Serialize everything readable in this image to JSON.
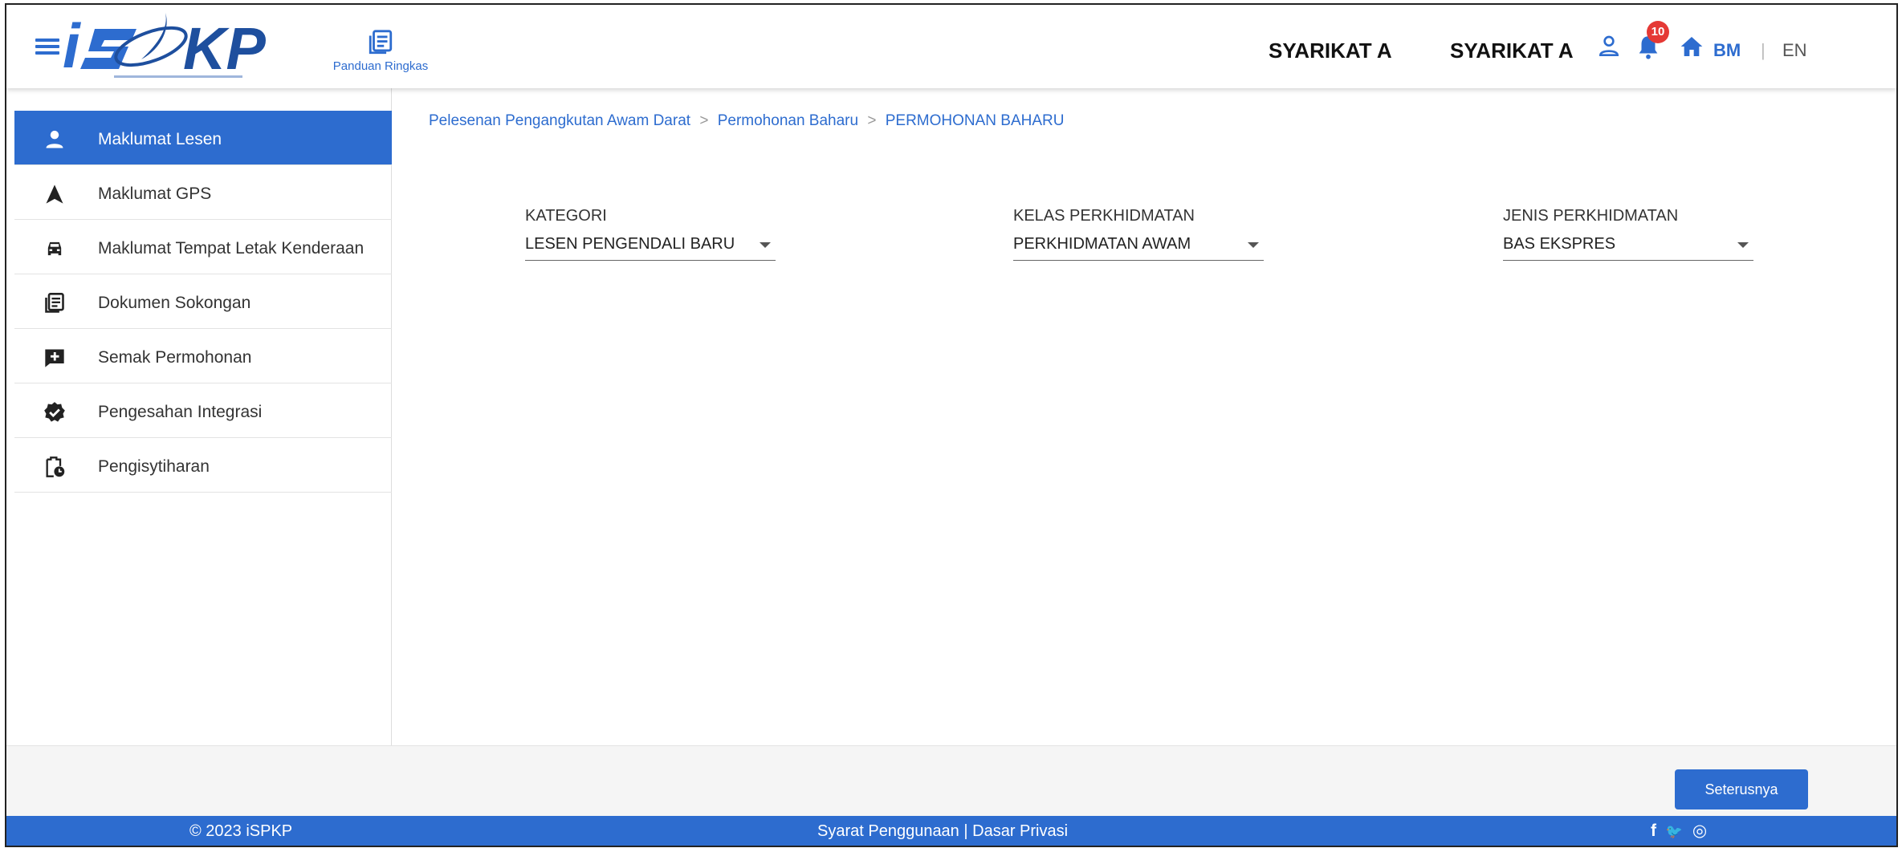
{
  "header": {
    "logo_text": "iSPKP",
    "guide_label": "Panduan Ringkas",
    "company_1": "SYARIKAT A",
    "company_2": "SYARIKAT A",
    "notification_count": "10",
    "lang_bm": "BM",
    "lang_sep": "|",
    "lang_en": "EN",
    "icons": [
      "menu-icon",
      "book-icon",
      "user-icon",
      "bell-icon",
      "home-icon"
    ]
  },
  "sidebar": {
    "items": [
      {
        "label": "Maklumat Lesen",
        "icon": "person-icon",
        "active": true
      },
      {
        "label": "Maklumat GPS",
        "icon": "navigation-arrow-icon",
        "active": false
      },
      {
        "label": "Maklumat Tempat Letak Kenderaan",
        "icon": "car-icon",
        "active": false
      },
      {
        "label": "Dokumen Sokongan",
        "icon": "document-stack-icon",
        "active": false
      },
      {
        "label": "Semak Permohonan",
        "icon": "comment-plus-icon",
        "active": false
      },
      {
        "label": "Pengesahan Integrasi",
        "icon": "verified-badge-icon",
        "active": false
      },
      {
        "label": "Pengisytiharan",
        "icon": "clipboard-clock-icon",
        "active": false
      }
    ]
  },
  "breadcrumb": {
    "items": [
      "Pelesenan Pengangkutan Awam Darat",
      "Permohonan Baharu",
      "PERMOHONAN BAHARU"
    ],
    "separator": ">"
  },
  "form": {
    "kategori": {
      "label": "KATEGORI",
      "value": "LESEN PENGENDALI BARU"
    },
    "kelas": {
      "label": "KELAS PERKHIDMATAN",
      "value": "PERKHIDMATAN AWAM"
    },
    "jenis": {
      "label": "JENIS PERKHIDMATAN",
      "value": "BAS EKSPRES"
    }
  },
  "actions": {
    "next_label": "Seterusnya"
  },
  "footer": {
    "copyright": "© 2023 iSPKP",
    "terms": "Syarat Penggunaan",
    "links_sep": " | ",
    "privacy": "Dasar Privasi",
    "social": {
      "facebook": "f",
      "twitter": "🐦",
      "instagram": "◎"
    }
  },
  "colors": {
    "primary": "#2d6ccf",
    "badge": "#e53935",
    "text": "#333333"
  }
}
